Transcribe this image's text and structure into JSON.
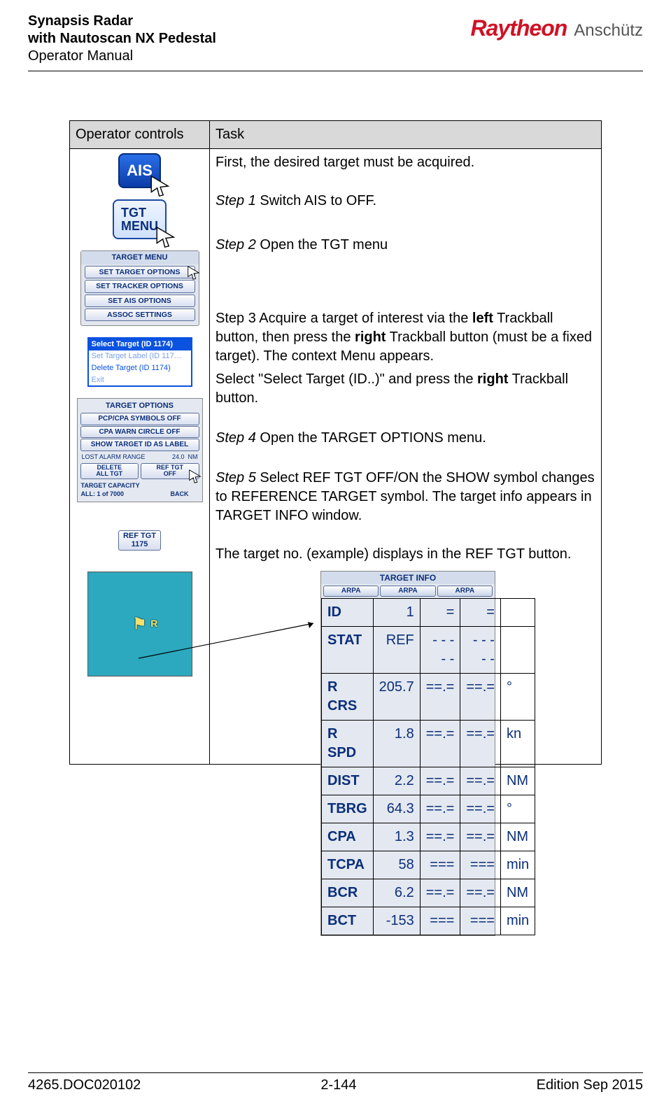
{
  "header": {
    "line1": "Synapsis Radar",
    "line2": "with Nautoscan NX Pedestal",
    "line3": "Operator Manual",
    "logo_brand": "Raytheon",
    "logo_sub": "Anschütz"
  },
  "table": {
    "col1_header": "Operator controls",
    "col2_header": "Task",
    "intro": "First, the desired target must be acquired.",
    "step1_label": "Step 1",
    "step1_text": " Switch AIS to OFF.",
    "step2_label": "Step 2",
    "step2_text": " Open the TGT menu",
    "step3_prefix": "Step 3 Acquire a target of interest via the ",
    "step3_left": "left",
    "step3_mid": " Trackball button, then press the ",
    "step3_right": "right",
    "step3_after": " Trackball button (must be a fixed target). The context Menu appears.",
    "step3b_prefix": "Select \"Select Target (ID..)\" and press the ",
    "step3b_right": "right",
    "step3b_after": " Trackball button.",
    "step4_label": "Step 4",
    "step4_text": " Open the TARGET OPTIONS menu.",
    "step5_label": "Step 5",
    "step5_text": " Select REF TGT OFF/ON the SHOW symbol changes to REFERENCE TARGET symbol. The target info appears in TARGET INFO window.",
    "ref_note": "The target no. (example) displays in the REF TGT button."
  },
  "controls": {
    "ais": "AIS",
    "tgtmenu_l1": "TGT",
    "tgtmenu_l2": "MENU",
    "tm_title": "TARGET MENU",
    "tm_opt1": "SET TARGET OPTIONS",
    "tm_opt2": "SET TRACKER OPTIONS",
    "tm_opt3": "SET AIS OPTIONS",
    "tm_opt4": "ASSOC SETTINGS",
    "ctx_sel": "Select Target (ID 1174)",
    "ctx_lbl": "Set Target Label (ID 117…",
    "ctx_del": "Delete Target (ID 1174)",
    "ctx_exit": "Exit",
    "to_title": "TARGET OPTIONS",
    "to_b1": "PCP/CPA SYMBOLS OFF",
    "to_b2": "CPA WARN CIRCLE OFF",
    "to_b3": "SHOW TARGET ID AS LABEL",
    "to_lost_l": "LOST ALARM RANGE",
    "to_lost_v": "24.0",
    "to_lost_u": "NM",
    "to_del1": "DELETE",
    "to_del2": "ALL TGT",
    "to_ref1": "REF TGT",
    "to_ref2": "OFF",
    "to_cap_l": "TARGET CAPACITY",
    "to_cap_v": "ALL: 1 of 7000",
    "to_back": "BACK",
    "ref_l1": "REF TGT",
    "ref_l2": "1175",
    "flag": "⚑",
    "flag_r": "R"
  },
  "target_info": {
    "title": "TARGET INFO",
    "tab": "ARPA",
    "rows": [
      {
        "l": "ID",
        "v1": "1",
        "v2": "=",
        "v3": "="
      },
      {
        "l": "STAT",
        "v1": "REF",
        "v2": "- - - - -",
        "v3": "- - - - -"
      },
      {
        "l": "R CRS",
        "v1": "205.7",
        "v2": "==.=",
        "v3": "==.=",
        "u": "°"
      },
      {
        "l": "R SPD",
        "v1": "1.8",
        "v2": "==.=",
        "v3": "==.=",
        "u": "kn"
      },
      {
        "l": "DIST",
        "v1": "2.2",
        "v2": "==.=",
        "v3": "==.=",
        "u": "NM"
      },
      {
        "l": "TBRG",
        "v1": "64.3",
        "v2": "==.=",
        "v3": "==.=",
        "u": "°"
      },
      {
        "l": "CPA",
        "v1": "1.3",
        "v2": "==.=",
        "v3": "==.=",
        "u": "NM"
      },
      {
        "l": "TCPA",
        "v1": "58",
        "v2": "===",
        "v3": "===",
        "u": "min"
      },
      {
        "l": "BCR",
        "v1": "6.2",
        "v2": "==.=",
        "v3": "==.=",
        "u": "NM"
      },
      {
        "l": "BCT",
        "v1": "-153",
        "v2": "===",
        "v3": "===",
        "u": "min"
      }
    ]
  },
  "footer": {
    "doc": "4265.DOC020102",
    "page": "2-144",
    "edition": "Edition Sep 2015"
  }
}
